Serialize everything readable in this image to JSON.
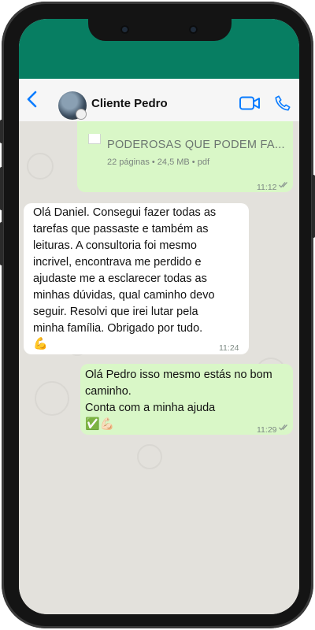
{
  "contact": {
    "name": "Cliente Pedro"
  },
  "messages": {
    "document": {
      "filename": "PODEROSAS QUE PODEM FA...",
      "meta": "22 páginas • 24,5 MB • pdf",
      "time": "11:12"
    },
    "incoming": {
      "text": "Olá Daniel. Consegui fazer todas as\ntarefas que passaste e também as\nleituras. A consultoria foi mesmo\nincrivel, encontrava me perdido e\najudaste me a esclarecer todas as\nminhas dúvidas, qual caminho devo\nseguir. Resolvi que irei lutar pela\nminha família. Obrigado por tudo.",
      "emoji": "💪",
      "time": "11:24"
    },
    "outgoing": {
      "line1": "Olá Pedro isso mesmo estás no bom",
      "line2": "caminho.",
      "line3": "Conta com a minha ajuda",
      "emoji": "✅💪🏻",
      "time": "11:29"
    }
  },
  "colors": {
    "header_green": "#077e62",
    "outgoing_bubble": "#d9f7c7",
    "incoming_bubble": "#ffffff",
    "ios_blue": "#0a7cff"
  }
}
